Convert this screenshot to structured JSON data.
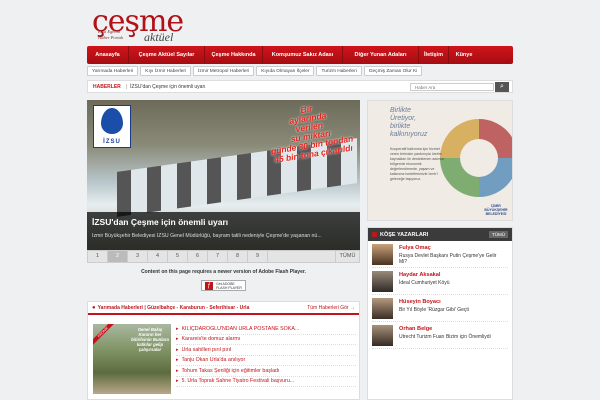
{
  "header": {
    "logo_main": "çeşme",
    "logo_sub1": "Kısa Egenin",
    "logo_sub2": "Haber Portalı",
    "logo_aktuel": "aktüel"
  },
  "nav": [
    "Anasayfa",
    "Çeşme Aktüel Sayılar",
    "Çeşme Hakkında",
    "Komşumuz Sakız Adası",
    "Diğer Yunan Adaları",
    "İletişim",
    "Künye"
  ],
  "subnav": [
    "Yarımada Haberleri",
    "Kıyı İzmir Haberleri",
    "İzmir Metropol Haberleri",
    "Kıyıda Olmayan İlçeler",
    "Turizm Haberleri",
    "Geçmiş Zaman Olur Ki"
  ],
  "ticker": {
    "label": "HABERLER",
    "sep": "|",
    "text": "İZSU'dan Çeşme için önemli uyarı",
    "search_placeholder": "Haber Ara",
    "search_icon": "search-icon"
  },
  "slider": {
    "logo_text": "İZSU",
    "promo": [
      "Bir",
      "aylarında",
      "verilen",
      "su miktarı",
      "günde 30 bin tondan",
      "45 bin tona çıkarıldı"
    ],
    "title": "İZSU'dan Çeşme için önemli uyarı",
    "desc": "İzmir Büyükşehir Belediyesi İZSU Genel Müdürlüğü, bayram tatili nedeniyle Çeşme'de yaşanan nü...",
    "pages": [
      "1",
      "2",
      "3",
      "4",
      "5",
      "6",
      "7",
      "8",
      "9"
    ],
    "active_page": "2",
    "all_label": "TÜMÜ"
  },
  "flash": {
    "message": "Content on this page requires a newer version of Adobe Flash Player.",
    "badge_line1": "Get ADOBE",
    "badge_line2": "FLASH PLAYER"
  },
  "news": {
    "categories": "Yarımada Haberleri | Güzelbahçe - Karaburun - Seferihisar - Urla",
    "all_label": "Tüm Haberleri Gör →",
    "image_caption": "Genel Bakış Kararın her bitirilsinin Bunlara katkılar gelip çalışırsalar",
    "image_tag": "KRONİK",
    "items": [
      "KILIÇDAROĞLU'NDAN URLA POSTANE SOKA...",
      "Karareis'te domuz alarmı",
      "Urla sahilleri pırıl pırıl",
      "Tanju Okan Urla'da anılıyor",
      "Tohum Takas Şenliği için eğitimler başladı",
      "5. Urla Toprak Sahne Tiyatro Festivali başvuru..."
    ]
  },
  "ad": {
    "line1": "Birlikte",
    "line2": "Üretiyor,",
    "line3": "birlikte",
    "line4": "kalkınıyoruz",
    "body": "Kooperatif kalkınma için hizmet veren birimizin yardımıyla üretim kaynakları ile desteklenen adımlar bölgemizi ekonomik değerlendirmede, yaşam ve kalkınma hedeflerimizle İzmir'i geleceğe taşıyoruz.",
    "logo": "İZMİR BÜYÜKŞEHİR BELEDİYESİ"
  },
  "writers": {
    "title": "KÖŞE YAZARLARI",
    "all_label": "TÜMÜ",
    "items": [
      {
        "name": "Fulya Omaç",
        "title": "Rusya Devlet Başkanı Putin Çeşme'ye Gelir Mi?"
      },
      {
        "name": "Haydar Aksakal",
        "title": "İdeal Cumhuriyet Köyü"
      },
      {
        "name": "Hüseyin Boyacı",
        "title": "Bir Yıl Böyle 'Rüzgar Gibi' Geçti"
      },
      {
        "name": "Orhan Belge",
        "title": "Utrecht Turizm Fuarı Bizim için Önemliydi"
      }
    ]
  }
}
